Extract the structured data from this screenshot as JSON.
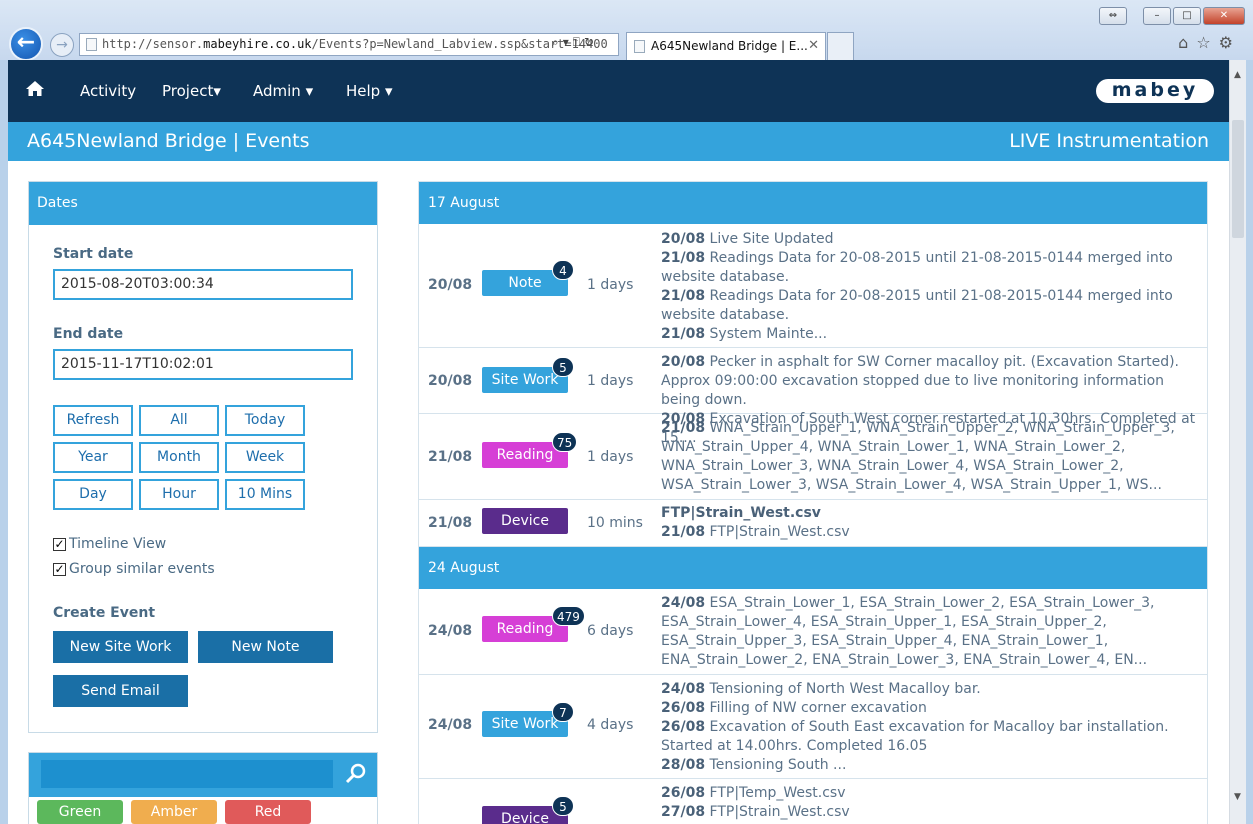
{
  "browser": {
    "url_prefix": "http://sensor.",
    "url_host": "mabeyhire.co.uk",
    "url_rest": "/Events?p=Newland_Labview.ssp&start=14400",
    "tab_title": "A645Newland Bridge | E..."
  },
  "nav": {
    "items": [
      "Activity",
      "Project▾",
      "Admin ▾",
      "Help ▾"
    ],
    "logo": "mabey"
  },
  "title": {
    "left": "A645Newland Bridge | Events",
    "right": "LIVE Instrumentation"
  },
  "dates_panel": {
    "header": "Dates",
    "start_label": "Start date",
    "start_value": "2015-08-20T03:00:34",
    "end_label": "End date",
    "end_value": "2015-11-17T10:02:01",
    "filters": [
      "Refresh",
      "All",
      "Today",
      "Year",
      "Month",
      "Week",
      "Day",
      "Hour",
      "10 Mins"
    ],
    "timeline_view": "Timeline View",
    "group_similar": "Group similar events",
    "create_event": "Create Event",
    "new_site_work": "New Site Work",
    "new_note": "New Note",
    "send_email": "Send Email"
  },
  "status_chips": [
    {
      "label": "Green",
      "color": "#5cb85c"
    },
    {
      "label": "Amber",
      "color": "#f0ad4e"
    },
    {
      "label": "Red",
      "color": "#e05a5a"
    }
  ],
  "colors": {
    "note": "#34a3dc",
    "site_work": "#34a3dc",
    "reading": "#d63fd6",
    "device": "#5a2c8c"
  },
  "days": [
    {
      "header": "17 August",
      "events": [
        {
          "date": "20/08",
          "type": "Note",
          "count": "4",
          "duration": "1 days",
          "lines": [
            [
              "20/08",
              "Live Site Updated"
            ],
            [
              "21/08",
              "Readings Data for 20-08-2015 until 21-08-2015-0144 merged into website database."
            ],
            [
              "21/08",
              "Readings Data for 20-08-2015 until 21-08-2015-0144 merged into website database."
            ],
            [
              "21/08",
              "System Mainte..."
            ]
          ]
        },
        {
          "date": "20/08",
          "type": "Site Work",
          "count": "5",
          "duration": "1 days",
          "lines": [
            [
              "20/08",
              "Pecker in asphalt for SW Corner macalloy pit. (Excavation Started). Approx 09:00:00 excavation stopped due to live monitoring information being down."
            ],
            [
              "20/08",
              "Excavation of South West corner restarted at 10.30hrs. Completed at 15...."
            ]
          ]
        },
        {
          "date": "21/08",
          "type": "Reading",
          "count": "75",
          "duration": "1 days",
          "lines": [
            [
              "21/08",
              "WNA_Strain_Upper_1, WNA_Strain_Upper_2, WNA_Strain_Upper_3, WNA_Strain_Upper_4, WNA_Strain_Lower_1, WNA_Strain_Lower_2, WNA_Strain_Lower_3, WNA_Strain_Lower_4, WSA_Strain_Lower_2, WSA_Strain_Lower_3, WSA_Strain_Lower_4, WSA_Strain_Upper_1, WS..."
            ]
          ]
        },
        {
          "date": "21/08",
          "type": "Device",
          "count": "",
          "duration": "10 mins",
          "lines": [
            [
              "FTP|Strain_West.csv",
              ""
            ],
            [
              "21/08",
              "FTP|Strain_West.csv"
            ]
          ]
        }
      ]
    },
    {
      "header": "24 August",
      "events": [
        {
          "date": "24/08",
          "type": "Reading",
          "count": "479",
          "duration": "6 days",
          "lines": [
            [
              "24/08",
              "ESA_Strain_Lower_1, ESA_Strain_Lower_2, ESA_Strain_Lower_3, ESA_Strain_Lower_4, ESA_Strain_Upper_1, ESA_Strain_Upper_2, ESA_Strain_Upper_3, ESA_Strain_Upper_4, ENA_Strain_Lower_1, ENA_Strain_Lower_2, ENA_Strain_Lower_3, ENA_Strain_Lower_4, EN..."
            ]
          ]
        },
        {
          "date": "24/08",
          "type": "Site Work",
          "count": "7",
          "duration": "4 days",
          "lines": [
            [
              "24/08",
              "Tensioning of North West Macalloy bar."
            ],
            [
              "26/08",
              "Filling of NW corner excavation"
            ],
            [
              "26/08",
              "Excavation of South East excavation for Macalloy bar installation. Started at 14.00hrs. Completed 16.05"
            ],
            [
              "28/08",
              "Tensioning South ..."
            ]
          ]
        },
        {
          "date": "",
          "type": "Device",
          "count": "5",
          "duration": "",
          "lines": [
            [
              "26/08",
              "FTP|Temp_West.csv"
            ],
            [
              "27/08",
              "FTP|Strain_West.csv"
            ]
          ]
        }
      ]
    }
  ]
}
